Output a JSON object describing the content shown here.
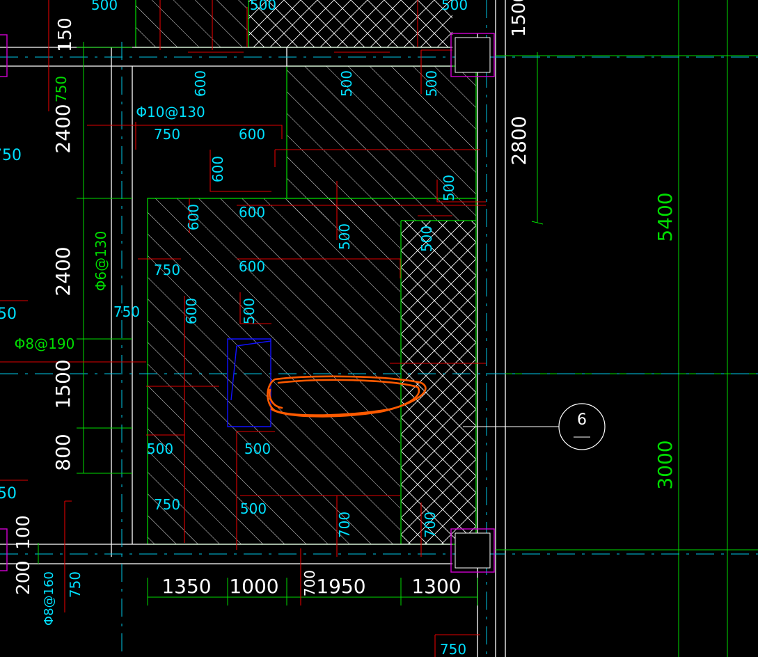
{
  "colors": {
    "background": "#000000",
    "wall": "#ffffff",
    "grid_axis": "#00c8e8",
    "slab_outline": "#00e000",
    "dim_green": "#00dd00",
    "rebar_red": "#e00000",
    "text_cyan": "#00e0ff",
    "hatch": "#ffffff",
    "column_magenta": "#d000d0",
    "markup_orange": "#ff5a00",
    "markup_blue": "#1010ff"
  },
  "drawing": {
    "top_labels": [
      "500",
      "500",
      "500",
      "1500"
    ],
    "left_dims": [
      "150",
      "750",
      "2400",
      "2400",
      "1500",
      "800",
      "100",
      "200"
    ],
    "left_edge_labels": [
      "750",
      "50",
      "50"
    ],
    "right_dims": [
      "2800",
      "5400",
      "3000"
    ],
    "bottom_dims": [
      "1350",
      "1000",
      "700",
      "1950",
      "1300",
      "750"
    ],
    "bottom_rebar_labels": [
      "750",
      "Φ8@160"
    ],
    "rebar_specs": [
      "Φ10@130",
      "Φ6@130",
      "Φ8@190"
    ],
    "slab_labels": [
      "750",
      "600",
      "600",
      "600",
      "600",
      "500",
      "500",
      "500",
      "500",
      "750",
      "600",
      "600",
      "600",
      "750",
      "500",
      "500",
      "750",
      "500",
      "700",
      "700",
      "500",
      "500"
    ],
    "axis_bubble": "6",
    "extra_600": "600"
  }
}
